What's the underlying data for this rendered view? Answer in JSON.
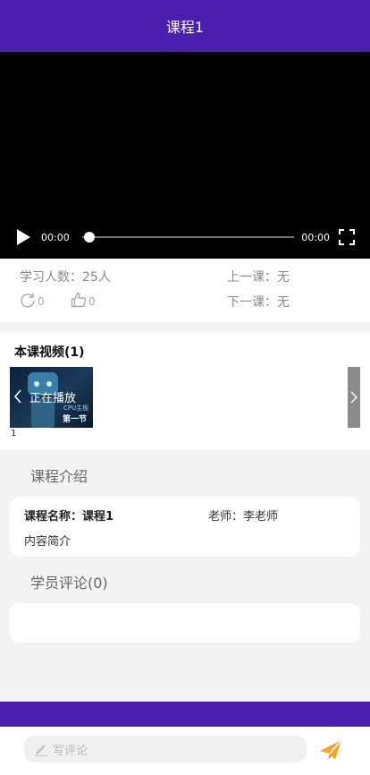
{
  "header": {
    "title": "课程1"
  },
  "player": {
    "current_time": "00:00",
    "duration": "00:00",
    "progress": 0
  },
  "stats": {
    "learners": "学习人数：25人",
    "prev_lesson": "上一课：无",
    "next_lesson": "下一课：无",
    "refresh_count": "0",
    "like_count": "0"
  },
  "videos": {
    "title": "本课视频(1)",
    "items": [
      {
        "status": "正在播放",
        "index": "1",
        "thumb_caption": "CPU主板",
        "thumb_part": "第一节"
      }
    ]
  },
  "intro": {
    "title": "课程介绍",
    "course_name": "课程名称：课程1",
    "teacher": "老师：李老师",
    "summary": "内容简介"
  },
  "comments": {
    "title": "学员评论(0)"
  },
  "comment_bar": {
    "placeholder": "写评论"
  },
  "colors": {
    "brand": "#4a1fb0",
    "send": "#f5a623"
  },
  "icons": [
    "play-icon",
    "fullscreen-icon",
    "refresh-icon",
    "thumbs-up-icon",
    "chevron-left-icon",
    "chevron-right-icon",
    "pencil-icon",
    "send-icon"
  ]
}
